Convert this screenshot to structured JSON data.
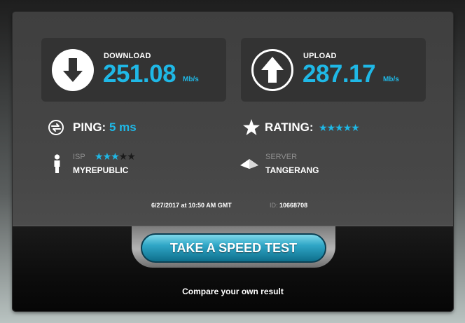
{
  "download": {
    "label": "DOWNLOAD",
    "value": "251.08",
    "unit": "Mb/s",
    "icon": "arrow-down-circle-icon"
  },
  "upload": {
    "label": "UPLOAD",
    "value": "287.17",
    "unit": "Mb/s",
    "icon": "arrow-up-circle-icon"
  },
  "ping": {
    "label": "PING:",
    "value": "5 ms",
    "icon": "ping-arrows-icon"
  },
  "rating": {
    "label": "RATING:",
    "stars_total": 5,
    "stars_filled": 5,
    "icon": "star-icon"
  },
  "isp": {
    "label": "ISP",
    "name": "MYREPUBLIC",
    "stars_total": 5,
    "stars_filled": 3,
    "icon": "person-icon"
  },
  "server": {
    "label": "SERVER",
    "name": "TANGERANG",
    "icon": "server-pyramid-icon"
  },
  "meta": {
    "date": "6/27/2017 at 10:50 AM GMT",
    "id_label": "ID:",
    "id_value": "10668708"
  },
  "cta": {
    "button_label": "TAKE A SPEED TEST",
    "compare_text": "Compare your own result"
  },
  "colors": {
    "accent": "#1fb8e6",
    "panel": "#333333",
    "button": "#2fa6c6"
  }
}
